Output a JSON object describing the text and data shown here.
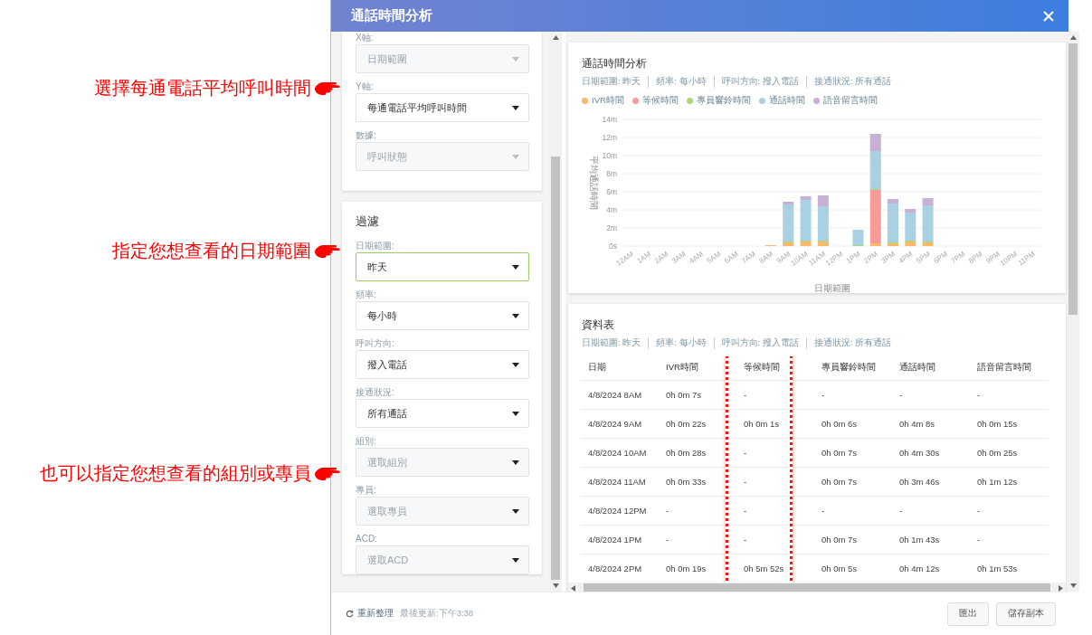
{
  "annotations": [
    {
      "text": "選擇每通電話平均呼叫時間"
    },
    {
      "text": "指定您想查看的日期範圍"
    },
    {
      "text": "也可以指定您想查看的組別或專員"
    }
  ],
  "dialog": {
    "title": "通話時間分析"
  },
  "settings_panel": {
    "fields": [
      {
        "label": "X軸:",
        "value": "日期範圍",
        "disabled": true
      },
      {
        "label": "Y軸:",
        "value": "每通電話平均呼叫時間",
        "disabled": false
      },
      {
        "label": "數據:",
        "value": "呼叫狀態",
        "disabled": true
      }
    ]
  },
  "filter_panel": {
    "title": "過濾",
    "fields": [
      {
        "label": "日期範圍:",
        "value": "昨天",
        "disabled": false,
        "focused": true
      },
      {
        "label": "頻率:",
        "value": "每小時",
        "disabled": false,
        "focused": false
      },
      {
        "label": "呼叫方向:",
        "value": "撥入電話",
        "disabled": false,
        "focused": false
      },
      {
        "label": "接通狀況:",
        "value": "所有通話",
        "disabled": false,
        "focused": false
      },
      {
        "label": "組別:",
        "placeholder": "選取組別",
        "disabled": false,
        "focused": false
      },
      {
        "label": "專員:",
        "placeholder": "選取專員",
        "disabled": false,
        "focused": false
      },
      {
        "label": "ACD:",
        "placeholder": "選取ACD",
        "disabled": false,
        "focused": false
      }
    ]
  },
  "chart_card": {
    "title": "通話時間分析",
    "filters": [
      "日期範圍: 昨天",
      "頻率: 每小時",
      "呼叫方向: 撥入電話",
      "接通狀況: 所有通話"
    ],
    "chart_data": {
      "type": "bar",
      "stacked": true,
      "grid": true,
      "xlabel": "日期範圍",
      "ylabel": "平均通話時間",
      "categories": [
        "12AM",
        "1AM",
        "2AM",
        "3AM",
        "4AM",
        "5AM",
        "6AM",
        "7AM",
        "8AM",
        "9AM",
        "10AM",
        "11AM",
        "12PM",
        "1PM",
        "2PM",
        "3PM",
        "4PM",
        "5PM",
        "6PM",
        "7PM",
        "8PM",
        "9PM",
        "10PM",
        "11PM"
      ],
      "ylim": [
        0,
        14
      ],
      "yticks": [
        {
          "value": 0,
          "label": "0s"
        },
        {
          "value": 2,
          "label": "2m"
        },
        {
          "value": 4,
          "label": "4m"
        },
        {
          "value": 6,
          "label": "6m"
        },
        {
          "value": 8,
          "label": "8m"
        },
        {
          "value": 10,
          "label": "10m"
        },
        {
          "value": 12,
          "label": "12m"
        },
        {
          "value": 14,
          "label": "14m"
        }
      ],
      "series": [
        {
          "name": "IVR時間",
          "color": "#f9b86a",
          "values": [
            null,
            null,
            null,
            null,
            null,
            null,
            null,
            null,
            0.1,
            0.4,
            0.5,
            0.5,
            null,
            null,
            0.3,
            0.3,
            0.5,
            0.4,
            null,
            null,
            null,
            null,
            null,
            null
          ]
        },
        {
          "name": "等候時間",
          "color": "#f79b98",
          "values": [
            null,
            null,
            null,
            null,
            null,
            null,
            null,
            null,
            null,
            null,
            null,
            null,
            null,
            null,
            5.9,
            null,
            null,
            null,
            null,
            null,
            null,
            null,
            null,
            null
          ]
        },
        {
          "name": "專員響鈴時間",
          "color": "#a6d97a",
          "values": [
            null,
            null,
            null,
            null,
            null,
            null,
            null,
            null,
            null,
            0.1,
            0.1,
            0.1,
            null,
            0.1,
            0.1,
            0.1,
            0.1,
            0.1,
            null,
            null,
            null,
            null,
            null,
            null
          ]
        },
        {
          "name": "通話時間",
          "color": "#a9d0e3",
          "values": [
            null,
            null,
            null,
            null,
            null,
            null,
            null,
            null,
            null,
            4.1,
            4.5,
            3.8,
            null,
            1.7,
            4.2,
            4.3,
            3.1,
            4.0,
            null,
            null,
            null,
            null,
            null,
            null
          ]
        },
        {
          "name": "語音留言時間",
          "color": "#c7afd6",
          "values": [
            null,
            null,
            null,
            null,
            null,
            null,
            null,
            null,
            null,
            0.3,
            0.4,
            1.2,
            null,
            null,
            1.9,
            0.5,
            0.4,
            0.8,
            null,
            null,
            null,
            null,
            null,
            null
          ]
        }
      ]
    }
  },
  "table_card": {
    "title": "資料表",
    "filters": [
      "日期範圍: 昨天",
      "頻率: 每小時",
      "呼叫方向: 撥入電話",
      "接通狀況: 所有通話"
    ],
    "columns": [
      {
        "label": "日期",
        "highlighted": false
      },
      {
        "label": "IVR時間",
        "highlighted": false
      },
      {
        "label": "等候時間",
        "highlighted": true
      },
      {
        "label": "專員響鈴時間",
        "highlighted": false
      },
      {
        "label": "通話時間",
        "highlighted": false
      },
      {
        "label": "語音留言時間",
        "highlighted": false
      }
    ],
    "rows": [
      [
        "4/8/2024 8AM",
        "0h 0m 7s",
        "-",
        "-",
        "-",
        "-"
      ],
      [
        "4/8/2024 9AM",
        "0h 0m 22s",
        "0h 0m 1s",
        "0h 0m 6s",
        "0h 4m 8s",
        "0h 0m 15s"
      ],
      [
        "4/8/2024 10AM",
        "0h 0m 28s",
        "-",
        "0h 0m 7s",
        "0h 4m 30s",
        "0h 0m 25s"
      ],
      [
        "4/8/2024 11AM",
        "0h 0m 33s",
        "-",
        "0h 0m 7s",
        "0h 3m 46s",
        "0h 1m 12s"
      ],
      [
        "4/8/2024 12PM",
        "-",
        "-",
        "-",
        "-",
        "-"
      ],
      [
        "4/8/2024 1PM",
        "-",
        "-",
        "0h 0m 7s",
        "0h 1m 43s",
        "-"
      ],
      [
        "4/8/2024 2PM",
        "0h 0m 19s",
        "0h 5m 52s",
        "0h 0m 5s",
        "0h 4m 12s",
        "0h 1m 53s"
      ]
    ]
  },
  "footer": {
    "refresh": "重新整理",
    "last_updated": "最後更新:下午3:38",
    "buttons": [
      "匯出",
      "儲存副本"
    ]
  }
}
